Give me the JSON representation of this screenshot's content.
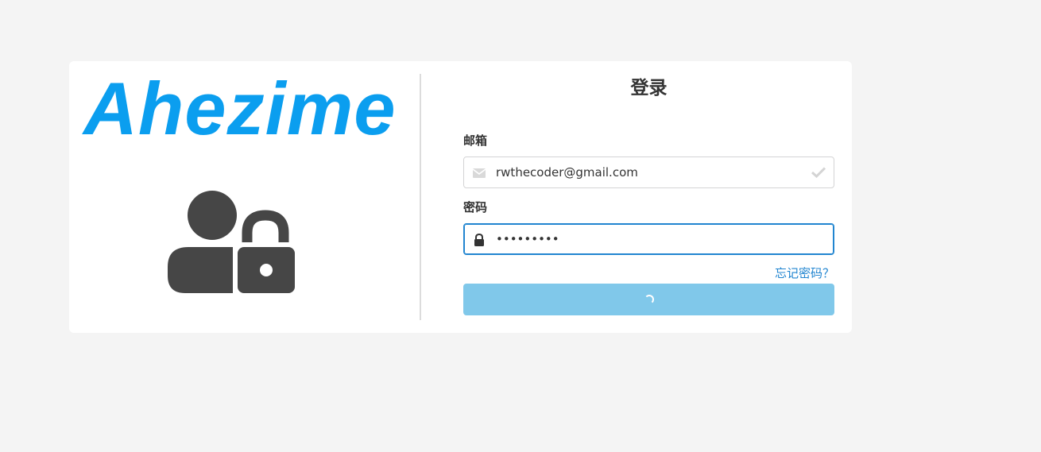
{
  "brand": {
    "logo_text": "Ahezime",
    "logo_color": "#0b9eef",
    "hero_icon": "user-lock-icon"
  },
  "form": {
    "title": "登录",
    "email": {
      "label": "邮箱",
      "value": "rwthecoder@gmail.com",
      "icon": "envelope-icon",
      "status_icon": "checkmark-icon"
    },
    "password": {
      "label": "密码",
      "value": "•••••••••",
      "icon": "lock-icon"
    },
    "forgot_link": "忘记密码？",
    "submit": {
      "state": "loading",
      "icon": "spinner-icon",
      "color": "#80c8ea"
    }
  }
}
